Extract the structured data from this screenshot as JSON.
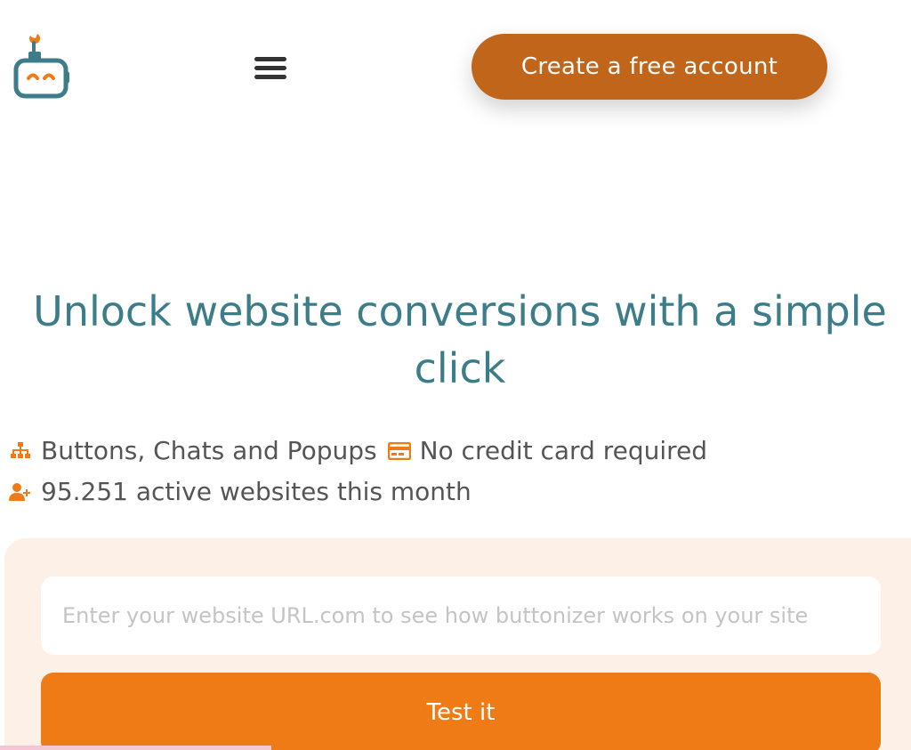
{
  "header": {
    "logo_icon": "robot-logo-icon",
    "menu_icon": "hamburger-menu-icon",
    "cta_label": "Create a free account"
  },
  "hero": {
    "title": "Unlock website conversions with a simple click"
  },
  "features": {
    "items": [
      {
        "icon": "sitemap-icon",
        "label": "Buttons, Chats and Popups"
      },
      {
        "icon": "credit-card-icon",
        "label": "No credit card required"
      },
      {
        "icon": "user-plus-icon",
        "label": "95.251 active websites this month"
      }
    ]
  },
  "form": {
    "url_placeholder": "Enter your website URL.com to see how buttonizer works on your site",
    "url_value": "",
    "submit_label": "Test it"
  },
  "colors": {
    "brand_teal": "#3c7d89",
    "brand_orange": "#ef7b16",
    "cta_brown": "#c0651a",
    "form_bg": "#fdf0e6",
    "text_gray": "#555555"
  }
}
